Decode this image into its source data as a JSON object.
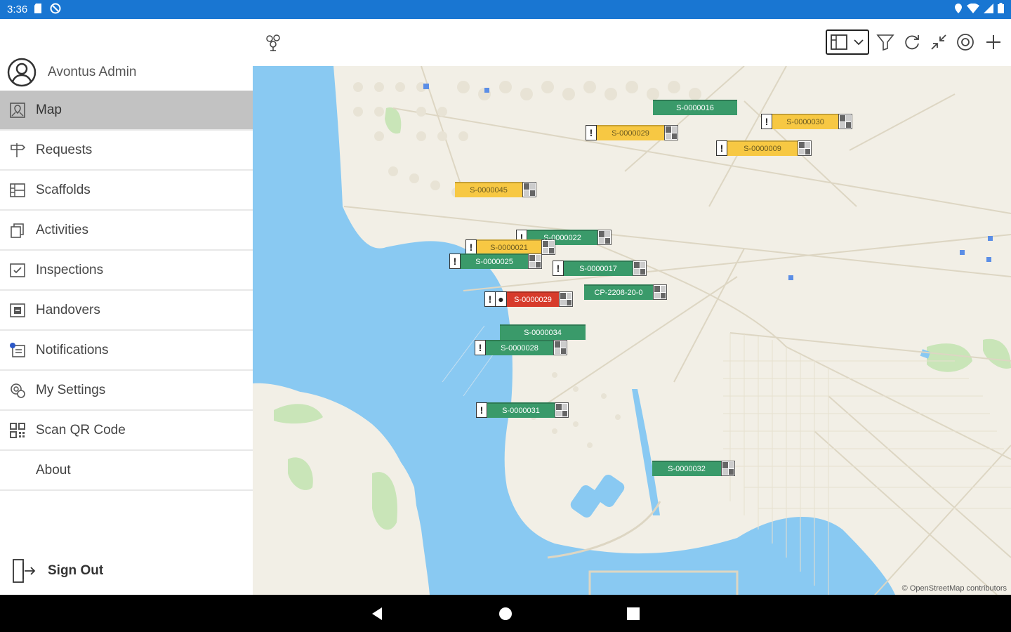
{
  "status": {
    "time": "3:36"
  },
  "drawer": {
    "user_name": "Avontus Admin",
    "items": [
      {
        "label": "Map",
        "icon": "map-pin-icon",
        "active": true
      },
      {
        "label": "Requests",
        "icon": "signpost-icon",
        "active": false
      },
      {
        "label": "Scaffolds",
        "icon": "scaffold-icon",
        "active": false
      },
      {
        "label": "Activities",
        "icon": "copy-icon",
        "active": false
      },
      {
        "label": "Inspections",
        "icon": "checkbox-icon",
        "active": false
      },
      {
        "label": "Handovers",
        "icon": "handover-icon",
        "active": false
      },
      {
        "label": "Notifications",
        "icon": "bell-icon",
        "active": false
      },
      {
        "label": "My Settings",
        "icon": "settings-icon",
        "active": false
      },
      {
        "label": "Scan QR Code",
        "icon": "qr-code-icon",
        "active": false
      },
      {
        "label": "About",
        "icon": "",
        "active": false
      }
    ],
    "sign_out": "Sign Out"
  },
  "toolbar": {
    "icons": [
      "location-pins-icon",
      "layout-select-icon",
      "filter-icon",
      "refresh-icon",
      "collapse-icon",
      "target-icon",
      "add-icon"
    ]
  },
  "map": {
    "markers": [
      {
        "label": "S-0000016",
        "status": "green",
        "warn": false,
        "qr": false
      },
      {
        "label": "S-0000029",
        "status": "yellow",
        "warn": true,
        "qr": true
      },
      {
        "label": "S-0000030",
        "status": "yellow",
        "warn": true,
        "qr": true
      },
      {
        "label": "S-0000009",
        "status": "yellow",
        "warn": true,
        "qr": true
      },
      {
        "label": "S-0000045",
        "status": "yellow",
        "warn": false,
        "qr": true
      },
      {
        "label": "S-0000022",
        "status": "green",
        "warn": true,
        "qr": true
      },
      {
        "label": "S-0000021",
        "status": "yellow",
        "warn": true,
        "qr": true
      },
      {
        "label": "S-0000025",
        "status": "green",
        "warn": true,
        "qr": true
      },
      {
        "label": "S-0000017",
        "status": "green",
        "warn": true,
        "qr": true
      },
      {
        "label": "CP-2208-20-0",
        "status": "green",
        "warn": false,
        "qr": true
      },
      {
        "label": "S-0000029",
        "status": "red",
        "warn": true,
        "qr": true
      },
      {
        "label": "S-0000034",
        "status": "green",
        "warn": false,
        "qr": false
      },
      {
        "label": "S-0000028",
        "status": "green",
        "warn": true,
        "qr": true
      },
      {
        "label": "S-0000031",
        "status": "green",
        "warn": true,
        "qr": true
      },
      {
        "label": "S-0000032",
        "status": "green",
        "warn": false,
        "qr": true
      }
    ],
    "attribution": "© OpenStreetMap contributors"
  },
  "colors": {
    "status_bar": "#1976d2",
    "water": "#89c9f2",
    "land": "#f2efe6",
    "active_item": "#c2c2c2",
    "green": "#3a9a6a",
    "yellow": "#f7c843",
    "red": "#d73b2b"
  }
}
